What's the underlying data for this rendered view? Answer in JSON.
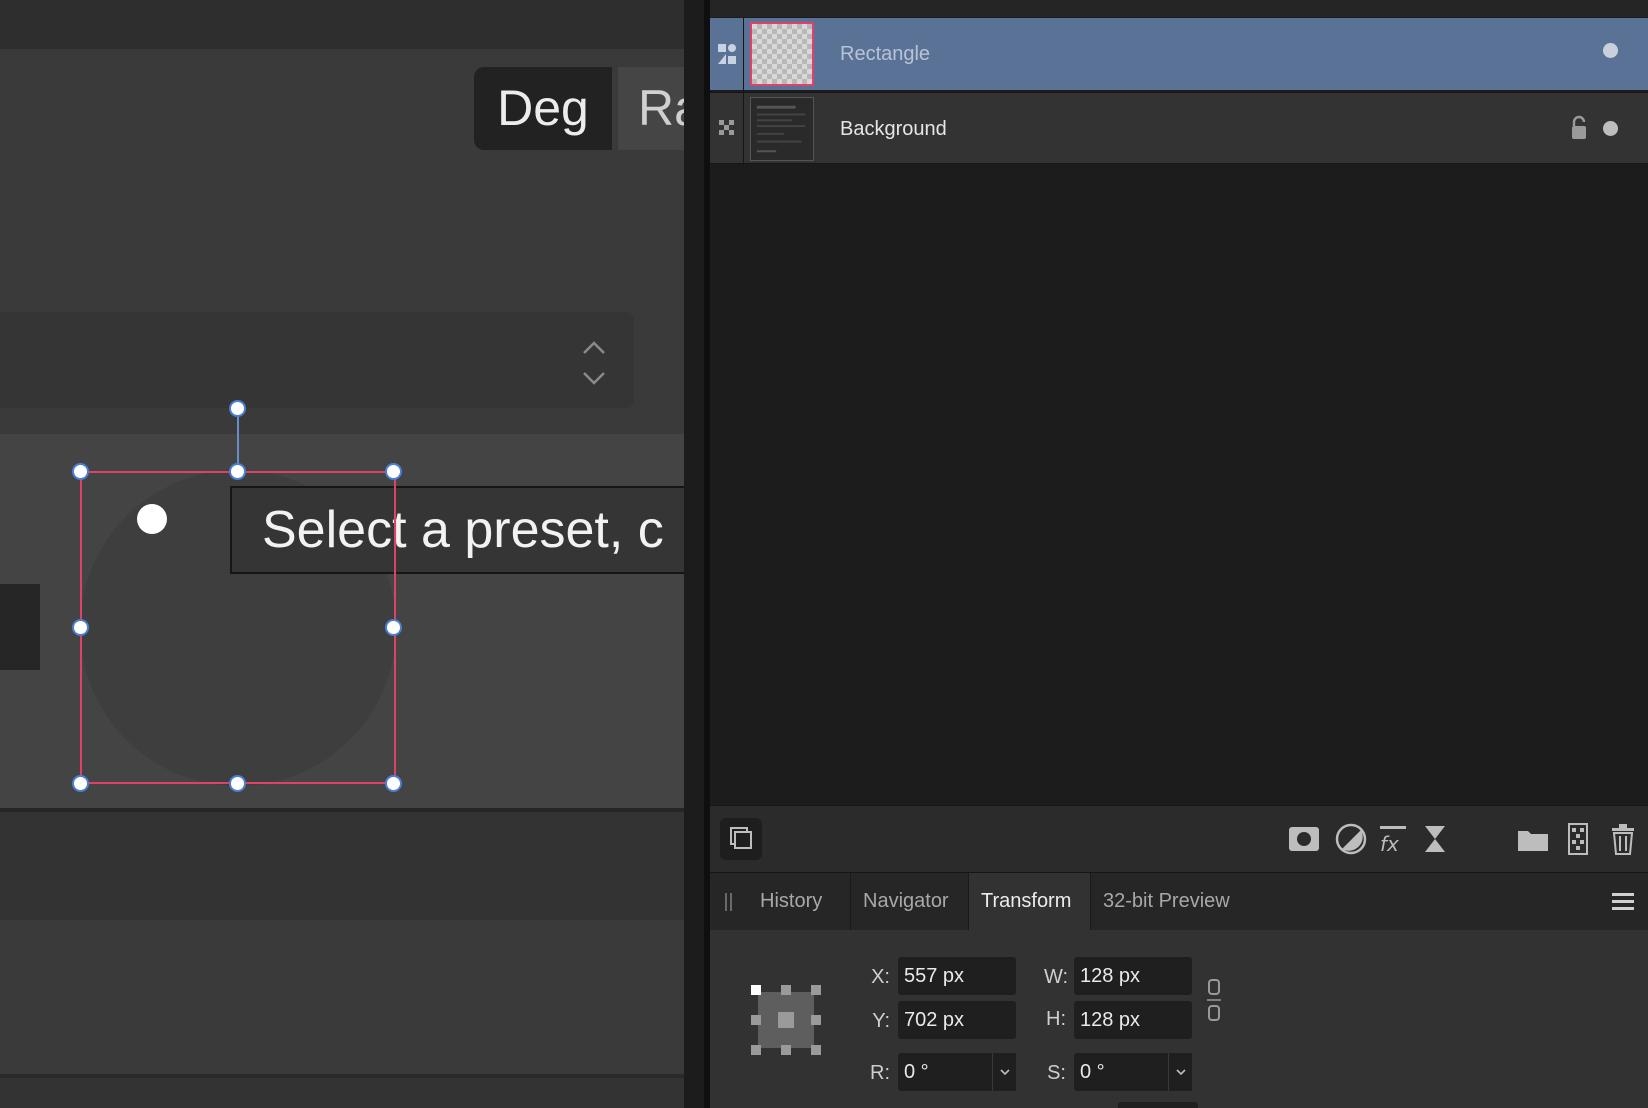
{
  "canvas": {
    "deg_label": "Deg",
    "rad_label_clipped": "Ra",
    "tooltip_text": "Select a preset, c"
  },
  "layers": {
    "items": [
      {
        "name": "Rectangle",
        "selected": true
      },
      {
        "name": "Background",
        "selected": false,
        "locked": true
      }
    ]
  },
  "panel_tabs": [
    {
      "label": "History",
      "active": false
    },
    {
      "label": "Navigator",
      "active": false
    },
    {
      "label": "Transform",
      "active": true
    },
    {
      "label": "32-bit Preview",
      "active": false
    }
  ],
  "transform": {
    "x_label": "X:",
    "x_value": "557 px",
    "y_label": "Y:",
    "y_value": "702 px",
    "w_label": "W:",
    "w_value": "128 px",
    "h_label": "H:",
    "h_value": "128 px",
    "r_label": "R:",
    "r_value": "0 °",
    "s_label": "S:",
    "s_value": "0 °"
  },
  "colors": {
    "selection_row": "#5a7296",
    "selection_border": "#e0416a",
    "handle_outline": "#4a7fd4"
  }
}
